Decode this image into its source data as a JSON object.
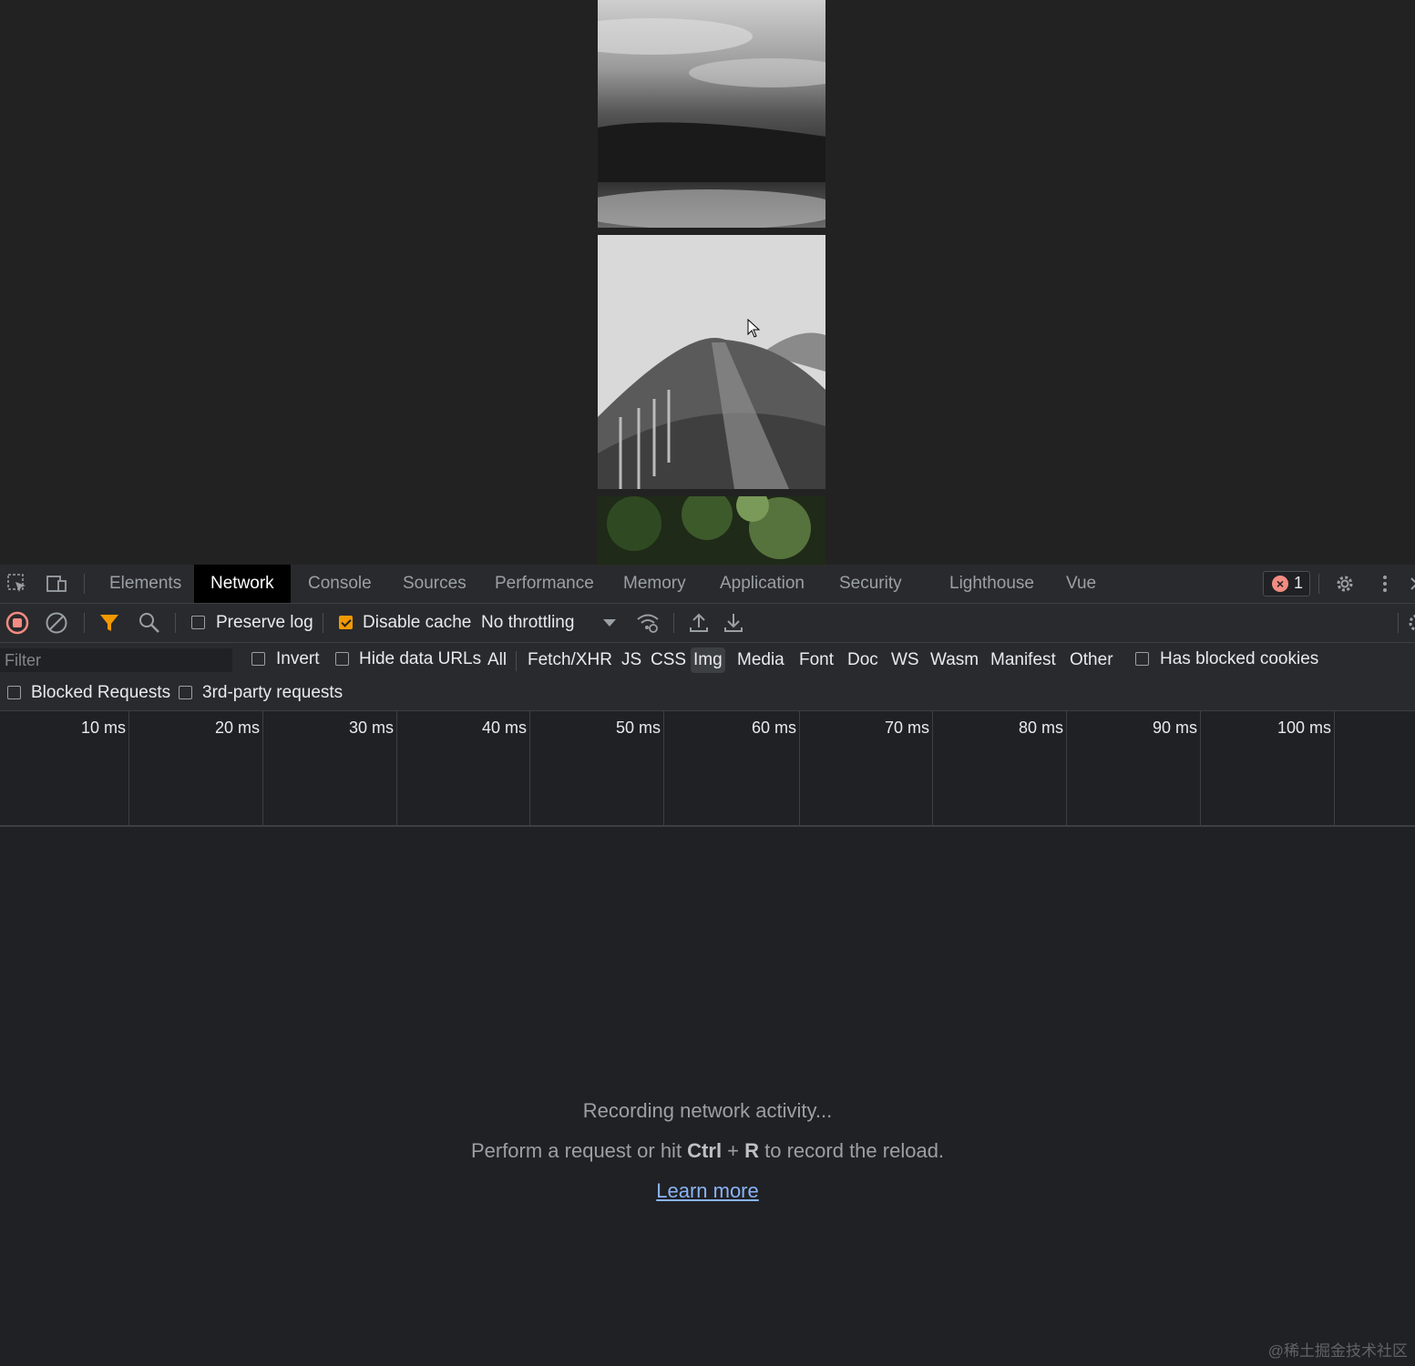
{
  "devtools": {
    "tabs": [
      "Elements",
      "Network",
      "Console",
      "Sources",
      "Performance",
      "Memory",
      "Application",
      "Security",
      "Lighthouse",
      "Vue"
    ],
    "active_tab": "Network",
    "error_count": "1"
  },
  "toolbar": {
    "preserve_log": {
      "label": "Preserve log",
      "checked": false
    },
    "disable_cache": {
      "label": "Disable cache",
      "checked": true
    },
    "throttling": "No throttling"
  },
  "filterbar": {
    "filter_placeholder": "Filter",
    "invert": {
      "label": "Invert",
      "checked": false
    },
    "hide_data_urls": {
      "label": "Hide data URLs",
      "checked": false
    },
    "types": [
      "All",
      "Fetch/XHR",
      "JS",
      "CSS",
      "Img",
      "Media",
      "Font",
      "Doc",
      "WS",
      "Wasm",
      "Manifest",
      "Other"
    ],
    "selected_type": "Img",
    "has_blocked_cookies": {
      "label": "Has blocked cookies",
      "checked": false
    },
    "blocked_requests": {
      "label": "Blocked Requests",
      "checked": false
    },
    "third_party": {
      "label": "3rd-party requests",
      "checked": false
    }
  },
  "overview": {
    "ticks": [
      "10 ms",
      "20 ms",
      "30 ms",
      "40 ms",
      "50 ms",
      "60 ms",
      "70 ms",
      "80 ms",
      "90 ms",
      "100 ms"
    ]
  },
  "empty_state": {
    "recording": "Recording network activity...",
    "hint_prefix": "Perform a request or hit ",
    "hint_key1": "Ctrl",
    "hint_plus": " + ",
    "hint_key2": "R",
    "hint_suffix": " to record the reload.",
    "learn_more": "Learn more"
  },
  "watermark": "@稀土掘金技术社区",
  "colors": {
    "accent_orange": "#f29900",
    "error_red": "#f28b82",
    "link_blue": "#8ab4f8",
    "record_red": "#f28b82"
  }
}
